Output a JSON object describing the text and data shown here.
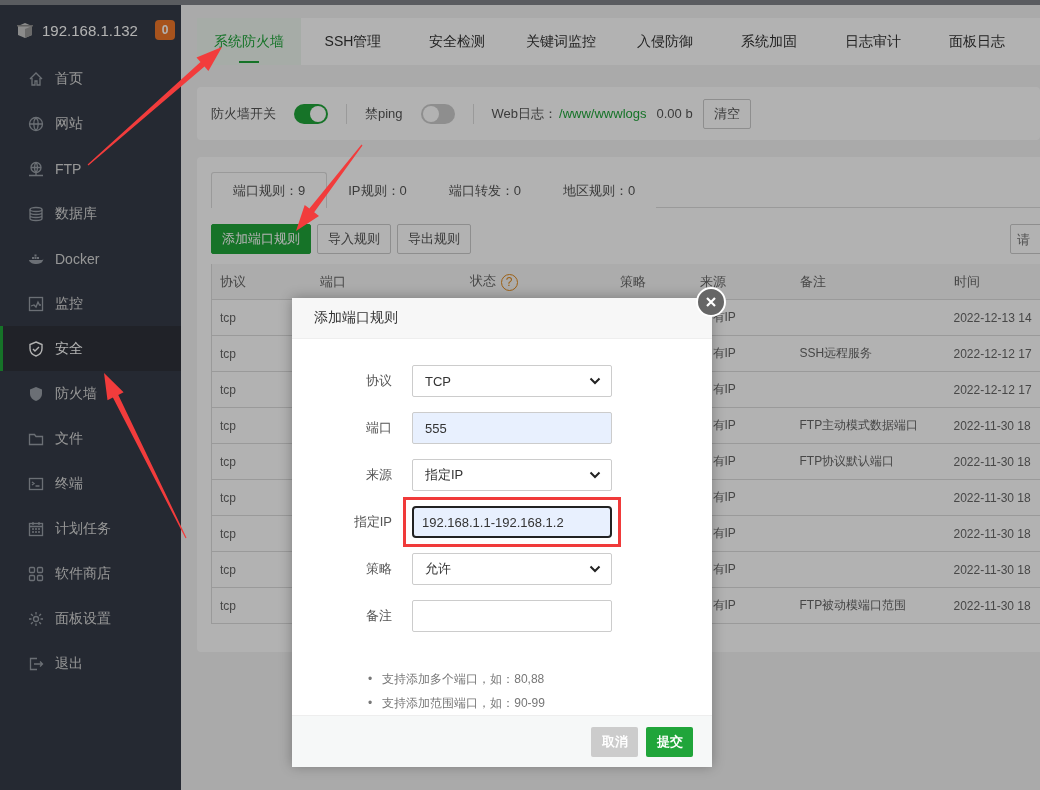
{
  "sidebar": {
    "host": "192.168.1.132",
    "badge": "0",
    "items": [
      {
        "label": "首页",
        "selected": false
      },
      {
        "label": "网站",
        "selected": false
      },
      {
        "label": "FTP",
        "selected": false
      },
      {
        "label": "数据库",
        "selected": false
      },
      {
        "label": "Docker",
        "selected": false
      },
      {
        "label": "监控",
        "selected": false
      },
      {
        "label": "安全",
        "selected": true
      },
      {
        "label": "防火墙",
        "selected": false
      },
      {
        "label": "文件",
        "selected": false
      },
      {
        "label": "终端",
        "selected": false
      },
      {
        "label": "计划任务",
        "selected": false
      },
      {
        "label": "软件商店",
        "selected": false
      },
      {
        "label": "面板设置",
        "selected": false
      },
      {
        "label": "退出",
        "selected": false
      }
    ]
  },
  "tabs": [
    {
      "label": "系统防火墙",
      "selected": true
    },
    {
      "label": "SSH管理",
      "selected": false
    },
    {
      "label": "安全检测",
      "selected": false
    },
    {
      "label": "关键词监控",
      "selected": false
    },
    {
      "label": "入侵防御",
      "selected": false
    },
    {
      "label": "系统加固",
      "selected": false
    },
    {
      "label": "日志审计",
      "selected": false
    },
    {
      "label": "面板日志",
      "selected": false
    }
  ],
  "toolbar": {
    "firewall": {
      "label": "防火墙开关",
      "on": true
    },
    "ping": {
      "label": "禁ping",
      "on": false
    },
    "web_log": {
      "label": "Web日志：",
      "path": "/www/wwwlogs",
      "size": "0.00 b",
      "button": "清空"
    }
  },
  "rules": {
    "tabs": [
      {
        "label": "端口规则：9",
        "selected": true
      },
      {
        "label": "IP规则：0",
        "selected": false
      },
      {
        "label": "端口转发：0",
        "selected": false
      },
      {
        "label": "地区规则：0",
        "selected": false
      }
    ],
    "buttons": [
      {
        "label": "添加端口规则",
        "kind": "primary"
      },
      {
        "label": "导入规则",
        "kind": "default"
      },
      {
        "label": "导出规则",
        "kind": "default"
      }
    ],
    "search": {
      "placeholder": "请"
    },
    "table": {
      "columns": [
        {
          "label": "协议"
        },
        {
          "label": "端口"
        },
        {
          "label": "状态",
          "help": "?"
        },
        {
          "label": "策略"
        },
        {
          "label": "来源"
        },
        {
          "label": "备注"
        },
        {
          "label": "时间"
        }
      ],
      "rows": [
        {
          "protocol": "tcp",
          "source": "有IP",
          "time": "2022-12-13 14"
        },
        {
          "protocol": "tcp",
          "source": "有IP",
          "note": "SSH远程服务",
          "time": "2022-12-12 17"
        },
        {
          "protocol": "tcp",
          "source": "有IP",
          "time": "2022-12-12 17"
        },
        {
          "protocol": "tcp",
          "source": "有IP",
          "note": "FTP主动模式数据端口",
          "time": "2022-11-30 18"
        },
        {
          "protocol": "tcp",
          "source": "有IP",
          "note": "FTP协议默认端口",
          "time": "2022-11-30 18"
        },
        {
          "protocol": "tcp",
          "source": "有IP",
          "time": "2022-11-30 18"
        },
        {
          "protocol": "tcp",
          "source": "有IP",
          "time": "2022-11-30 18"
        },
        {
          "protocol": "tcp",
          "source": "有IP",
          "time": "2022-11-30 18"
        },
        {
          "protocol": "tcp",
          "source": "有IP",
          "note": "FTP被动模端口范围",
          "time": "2022-11-30 18"
        }
      ]
    }
  },
  "dialog": {
    "title": "添加端口规则",
    "fields": [
      {
        "label": "协议",
        "kind": "select",
        "value": "TCP"
      },
      {
        "label": "端口",
        "kind": "input",
        "value": "555",
        "autofilled": true
      },
      {
        "label": "来源",
        "kind": "select",
        "value": "指定IP"
      },
      {
        "label": "指定IP",
        "kind": "input",
        "value": "192.168.1.1-192.168.1.2",
        "autofilled": true,
        "focused": true,
        "annotated": true
      },
      {
        "label": "策略",
        "kind": "select",
        "value": "允许"
      },
      {
        "label": "备注",
        "kind": "input"
      }
    ],
    "notes": [
      {
        "bullet": "•",
        "text": "支持添加多个端口，如：80,88"
      },
      {
        "bullet": "•",
        "text": "支持添加范围端口，如：90-99"
      }
    ],
    "buttons": [
      {
        "label": "取消",
        "kind": "cancel"
      },
      {
        "label": "提交",
        "kind": "primary"
      }
    ]
  }
}
